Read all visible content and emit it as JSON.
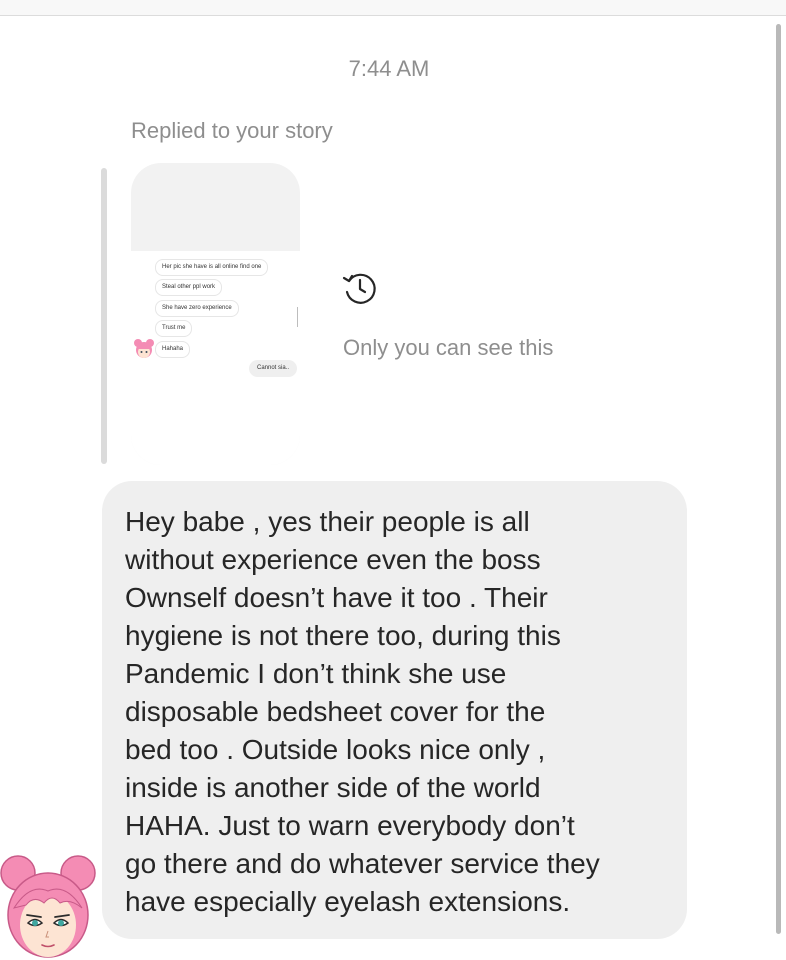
{
  "thread": {
    "timestamp": "7:44 AM",
    "reply_label": "Replied to your story",
    "visibility_note": "Only you can see this",
    "timer_icon": "clock-history-icon"
  },
  "story_preview": {
    "received_messages": [
      "Her pic she have is all online find one",
      "Steal other ppl work",
      "She have zero experience",
      "Trust me",
      "Hahaha"
    ],
    "sent_message": "Cannot sia.."
  },
  "message": {
    "lines": [
      "Hey babe , yes their people is all",
      "without experience even the boss",
      "Ownself doesn’t have it too . Their",
      "hygiene is not there too, during this",
      "Pandemic I don’t think she use",
      "disposable bedsheet cover for the",
      "bed too . Outside looks nice only ,",
      "inside is another side of the world",
      "HAHA. Just to warn everybody don’t",
      "go there and do whatever service they",
      "have especially eyelash extensions."
    ]
  },
  "colors": {
    "bubble": "#efefef",
    "muted_text": "#8e8e8e",
    "text": "#262626",
    "avatar_hair": "#f48cb4"
  }
}
